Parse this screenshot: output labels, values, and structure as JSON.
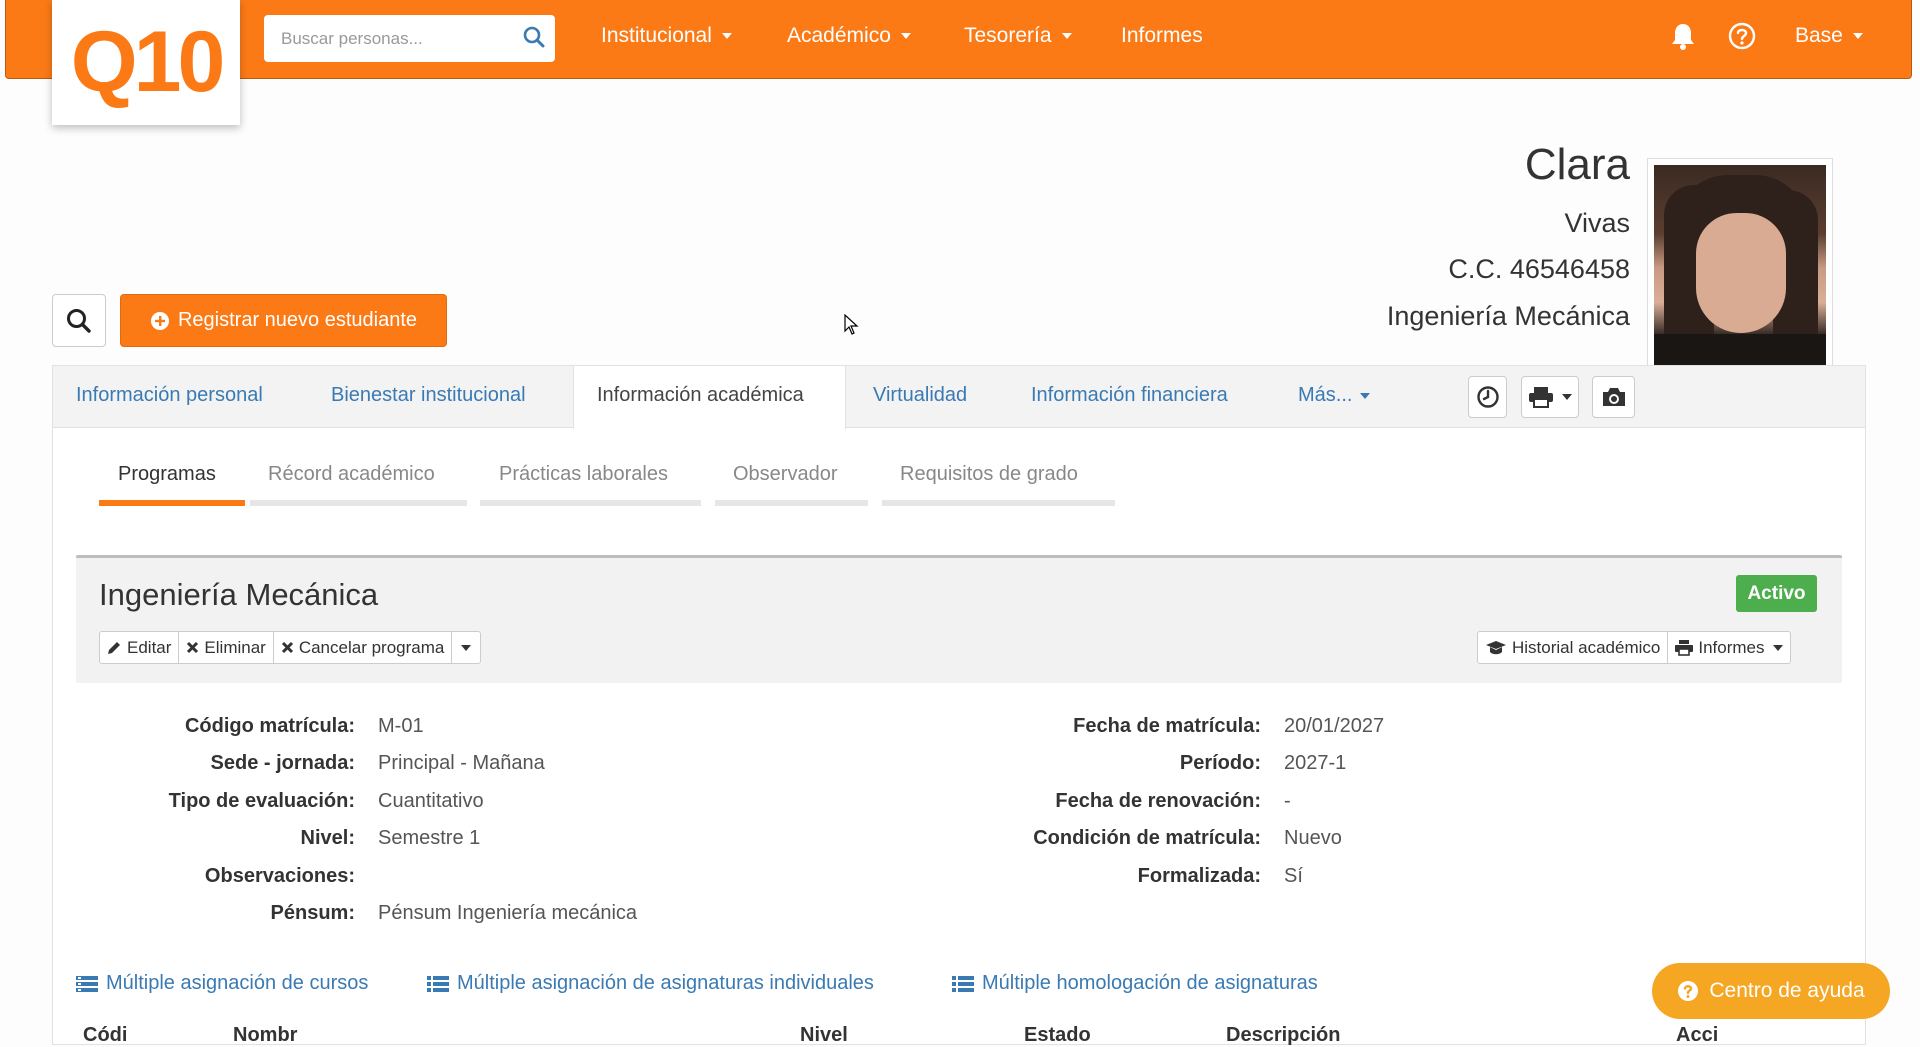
{
  "brand": {
    "logo_text": "Q10",
    "accent": "#fb7a16"
  },
  "search": {
    "placeholder": "Buscar personas..."
  },
  "nav": {
    "items": [
      {
        "label": "Institucional"
      },
      {
        "label": "Académico"
      },
      {
        "label": "Tesorería"
      },
      {
        "label": "Informes"
      }
    ],
    "user_menu": "Base"
  },
  "student": {
    "first_name": "Clara",
    "last_name": "Vivas",
    "id_doc": "C.C. 46546458",
    "program": "Ingeniería Mecánica"
  },
  "actions": {
    "register_label": "Registrar nuevo estudiante"
  },
  "tabs": [
    {
      "label": "Información personal"
    },
    {
      "label": "Bienestar institucional"
    },
    {
      "label": "Información académica"
    },
    {
      "label": "Virtualidad"
    },
    {
      "label": "Información financiera"
    },
    {
      "label": "Más..."
    }
  ],
  "subtabs": [
    {
      "label": "Programas"
    },
    {
      "label": "Récord académico"
    },
    {
      "label": "Prácticas laborales"
    },
    {
      "label": "Observador"
    },
    {
      "label": "Requisitos de grado"
    }
  ],
  "program_card": {
    "title": "Ingeniería Mecánica",
    "status": "Activo",
    "status_color": "#4cae4c",
    "buttons": {
      "edit": "Editar",
      "delete": "Eliminar",
      "cancel": "Cancelar programa",
      "history": "Historial académico",
      "reports": "Informes"
    }
  },
  "details_left": [
    {
      "label": "Código matrícula:",
      "value": "M-01"
    },
    {
      "label": "Sede - jornada:",
      "value": "Principal - Mañana"
    },
    {
      "label": "Tipo de evaluación:",
      "value": "Cuantitativo"
    },
    {
      "label": "Nivel:",
      "value": "Semestre 1"
    },
    {
      "label": "Observaciones:",
      "value": ""
    },
    {
      "label": "Pénsum:",
      "value": "Pénsum Ingeniería mecánica"
    }
  ],
  "details_right": [
    {
      "label": "Fecha de matrícula:",
      "value": "20/01/2027"
    },
    {
      "label": "Período:",
      "value": "2027-1"
    },
    {
      "label": "Fecha de renovación:",
      "value": "-"
    },
    {
      "label": "Condición de matrícula:",
      "value": "Nuevo"
    },
    {
      "label": "Formalizada:",
      "value": "Sí"
    }
  ],
  "links": [
    {
      "label": "Múltiple asignación de cursos"
    },
    {
      "label": "Múltiple asignación de asignaturas individuales"
    },
    {
      "label": "Múltiple homologación de asignaturas"
    }
  ],
  "help": {
    "label": "Centro de ayuda"
  },
  "table_headers_partial": [
    "Códi",
    "Nombr",
    "Nivel",
    "Estado",
    "Descripción",
    "Acci"
  ]
}
